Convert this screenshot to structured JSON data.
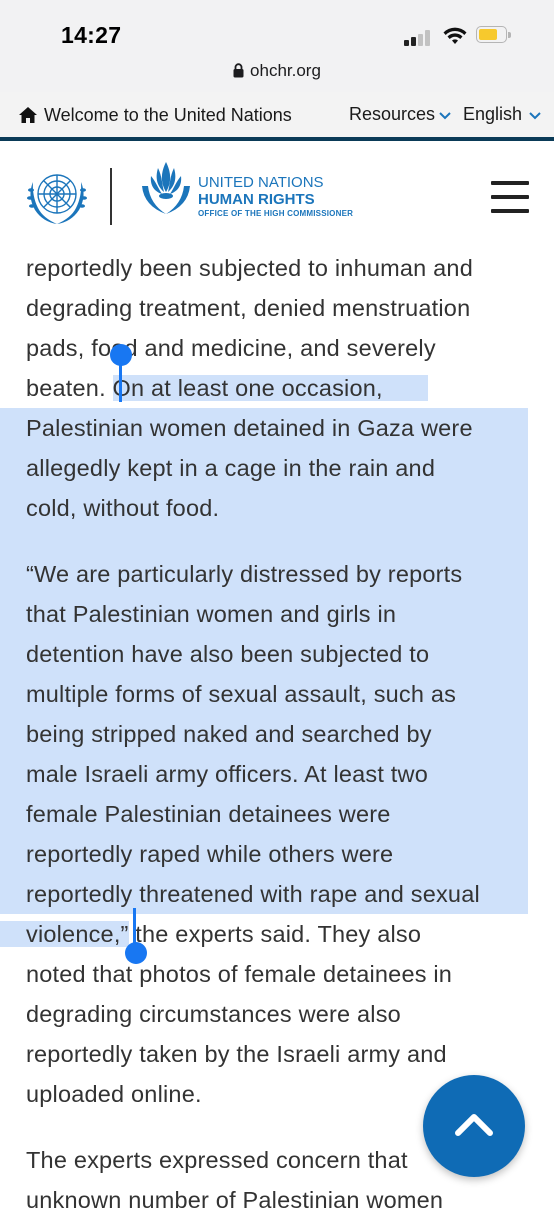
{
  "status_bar": {
    "time": "14:27"
  },
  "browser": {
    "url": "ohchr.org"
  },
  "topnav": {
    "welcome": "Welcome to the United Nations",
    "resources": "Resources",
    "language": "English"
  },
  "header": {
    "org_line1": "UNITED NATIONS",
    "org_line2": "HUMAN RIGHTS",
    "org_line3": "OFFICE OF THE HIGH COMMISSIONER"
  },
  "article": {
    "p1": {
      "line1": "reportedly been subjected to inhuman and",
      "line2": "degrading treatment, denied menstruation",
      "line3": "pads, food and medicine, and severely",
      "line4_pre": "beaten. ",
      "line4_sel": "On at least one occasion,",
      "line5": "Palestinian women detained in Gaza were",
      "line6": "allegedly kept in a cage in the rain and",
      "line7": "cold, without food."
    },
    "p2": {
      "line1": "“We are particularly distressed by reports",
      "line2": "that Palestinian women and girls in",
      "line3": "detention have also been subjected to",
      "line4": "multiple forms of sexual assault, such as",
      "line5": "being stripped naked and searched by",
      "line6": "male Israeli army officers. At least two",
      "line7": "female Palestinian detainees were",
      "line8": "reportedly raped while others were",
      "line9": "reportedly threatened with rape and sexual",
      "line10_sel": "violence,”",
      "line10_post": " the experts said. They also",
      "line11": "noted that photos of female detainees in",
      "line12": "degrading circumstances were also",
      "line13": "reportedly taken by the Israeli army and",
      "line14": "uploaded online."
    },
    "p3": {
      "line1": "The experts expressed concern that",
      "line2": "unknown number of Palestinian women"
    }
  },
  "icons": {
    "home": "home-icon",
    "chevron": "chevron-down-icon",
    "lock": "lock-icon",
    "menu": "hamburger-menu-icon",
    "scroll_top": "chevron-up-icon"
  },
  "colors": {
    "selection": "#cfe1fa",
    "handle": "#1877f2",
    "un_blue": "#1b75bb",
    "nav_border": "#0a3a57",
    "scroll_button": "#0f6bb5"
  }
}
